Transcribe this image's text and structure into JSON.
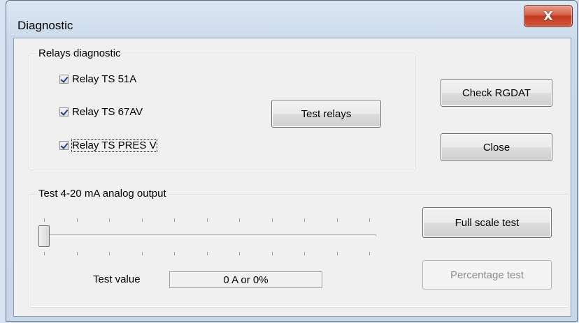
{
  "window": {
    "title": "Diagnostic",
    "close_glyph": "X"
  },
  "relays": {
    "group_label": "Relays diagnostic",
    "items": [
      {
        "label": "Relay TS 51A",
        "checked": true
      },
      {
        "label": "Relay TS 67AV",
        "checked": true
      },
      {
        "label": "Relay TS PRES V",
        "checked": true,
        "focused": true
      }
    ],
    "test_button": "Test relays"
  },
  "side_buttons": {
    "check": "Check RGDAT",
    "close": "Close"
  },
  "analog": {
    "group_label": "Test 4-20 mA analog output",
    "slider_value": 0,
    "test_value_label": "Test value",
    "test_value": "0 A or 0%",
    "full_scale_button": "Full scale test",
    "percentage_button": "Percentage test",
    "percentage_enabled": false
  }
}
